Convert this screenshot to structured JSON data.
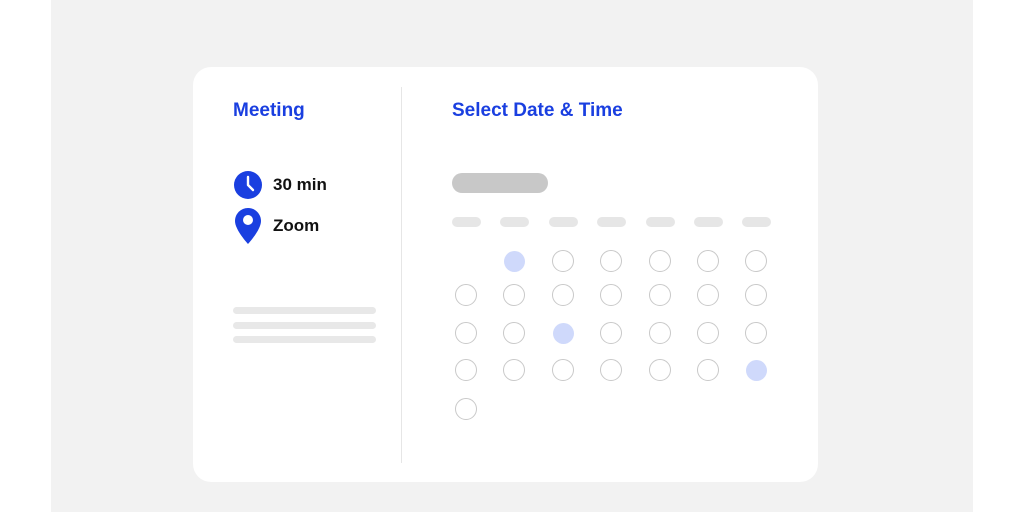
{
  "colors": {
    "accent": "#1a3fe0",
    "available_day": "#cfd9fb",
    "backdrop": "#f2f2f2",
    "card": "#ffffff"
  },
  "event": {
    "title": "Meeting",
    "details": [
      {
        "icon": "clock-icon",
        "text": "30 min"
      },
      {
        "icon": "location-pin-icon",
        "text": "Zoom"
      }
    ]
  },
  "scheduler": {
    "title": "Select Date & Time",
    "calendar": {
      "weekday_count": 7,
      "weeks": [
        [
          null,
          "available",
          "day",
          "day",
          "day",
          "day",
          "day"
        ],
        [
          "day",
          "day",
          "day",
          "day",
          "day",
          "day",
          "day"
        ],
        [
          "day",
          "day",
          "available",
          "day",
          "day",
          "day",
          "day"
        ],
        [
          "day",
          "day",
          "day",
          "day",
          "day",
          "day",
          "available"
        ],
        [
          "day",
          null,
          null,
          null,
          null,
          null,
          null
        ]
      ]
    }
  }
}
